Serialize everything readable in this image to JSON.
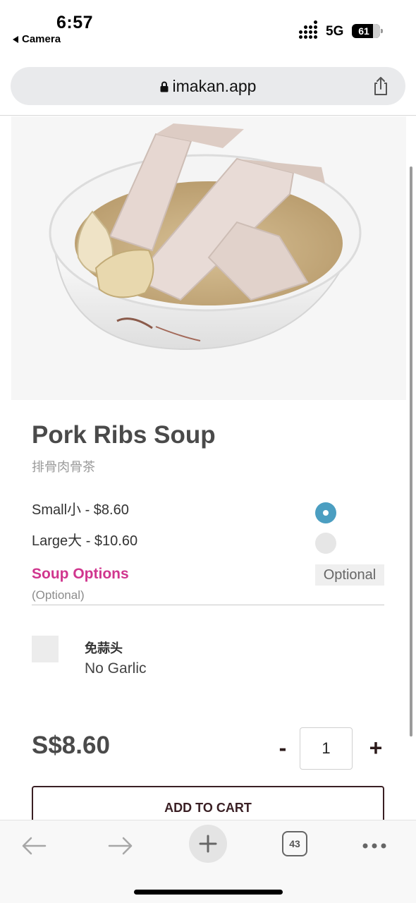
{
  "status_bar": {
    "time": "6:57",
    "back_app": "Camera",
    "network": "5G",
    "battery": "61"
  },
  "browser": {
    "url": "imakan.app",
    "tabs_count": "43",
    "icons": {
      "lock": "lock-icon",
      "share": "share-icon",
      "back": "back-arrow-icon",
      "forward": "forward-arrow-icon",
      "new_tab": "plus-icon",
      "more": "more-icon"
    }
  },
  "product": {
    "title": "Pork Ribs Soup",
    "subtitle": "排骨肉骨茶",
    "sizes": [
      {
        "label": "Small小 - $8.60",
        "selected": true
      },
      {
        "label": "Large大 - $10.60",
        "selected": false
      }
    ],
    "options_group": {
      "title": "Soup Options",
      "badge": "Optional",
      "subtitle": "(Optional)",
      "items": [
        {
          "label_cn": "免蒜头",
          "label_en": "No Garlic",
          "checked": false
        }
      ]
    },
    "price": "S$8.60",
    "quantity": "1",
    "minus_label": "-",
    "plus_label": "+",
    "add_to_cart": "ADD TO CART"
  },
  "colors": {
    "accent_pink": "#d0368e",
    "radio_selected": "#4b9ec1",
    "button_border": "#3a1f24"
  }
}
